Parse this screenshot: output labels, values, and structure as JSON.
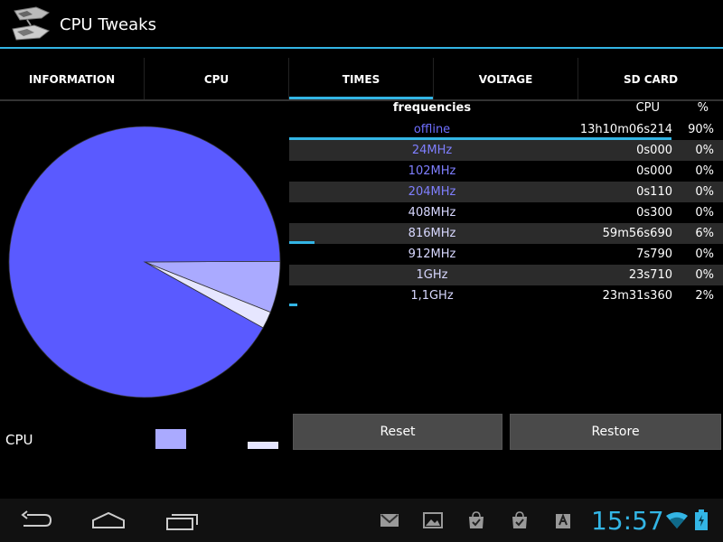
{
  "app": {
    "title": "CPU Tweaks",
    "icon": "app-logo-icon"
  },
  "tabs": [
    {
      "label": "INFORMATION",
      "selected": false
    },
    {
      "label": "CPU",
      "selected": false
    },
    {
      "label": "TIMES",
      "selected": true
    },
    {
      "label": "VOLTAGE",
      "selected": false
    },
    {
      "label": "SD CARD",
      "selected": false
    }
  ],
  "table": {
    "headers": {
      "freq": "frequencies",
      "cpu": "CPU",
      "pct": "%"
    },
    "rows": [
      {
        "freq": "offline",
        "time": "13h10m06s214",
        "pct": "90%",
        "pct_value": 90
      },
      {
        "freq": "24MHz",
        "time": "0s000",
        "pct": "0%",
        "pct_value": 0
      },
      {
        "freq": "102MHz",
        "time": "0s000",
        "pct": "0%",
        "pct_value": 0
      },
      {
        "freq": "204MHz",
        "time": "0s110",
        "pct": "0%",
        "pct_value": 0
      },
      {
        "freq": "408MHz",
        "time": "0s300",
        "pct": "0%",
        "pct_value": 0
      },
      {
        "freq": "816MHz",
        "time": "59m56s690",
        "pct": "6%",
        "pct_value": 6
      },
      {
        "freq": "912MHz",
        "time": "7s790",
        "pct": "0%",
        "pct_value": 0
      },
      {
        "freq": "1GHz",
        "time": "23s710",
        "pct": "0%",
        "pct_value": 0
      },
      {
        "freq": "1,1GHz",
        "time": "23m31s360",
        "pct": "2%",
        "pct_value": 2
      }
    ]
  },
  "chart_data": {
    "type": "pie",
    "title": "",
    "legend_title": "CPU",
    "slices": [
      {
        "label": "",
        "value": 90,
        "color": "#5a5aff"
      },
      {
        "label": "",
        "value": 6,
        "color": "#aaaaff"
      },
      {
        "label": "",
        "value": 2,
        "color": "#e6e6ff"
      }
    ]
  },
  "buttons": {
    "reset": "Reset",
    "restore": "Restore"
  },
  "statusbar": {
    "time": "15:57",
    "nav_icons": [
      "back-icon",
      "home-icon",
      "recent-apps-icon"
    ],
    "notification_icons": [
      "gmail-icon",
      "gallery-icon",
      "store-download-icon",
      "store-download-icon",
      "app-update-icon"
    ],
    "status_icons": [
      "wifi-icon",
      "battery-icon"
    ]
  },
  "colors": {
    "accent": "#33b5e5",
    "pie_main": "#5a5aff"
  }
}
